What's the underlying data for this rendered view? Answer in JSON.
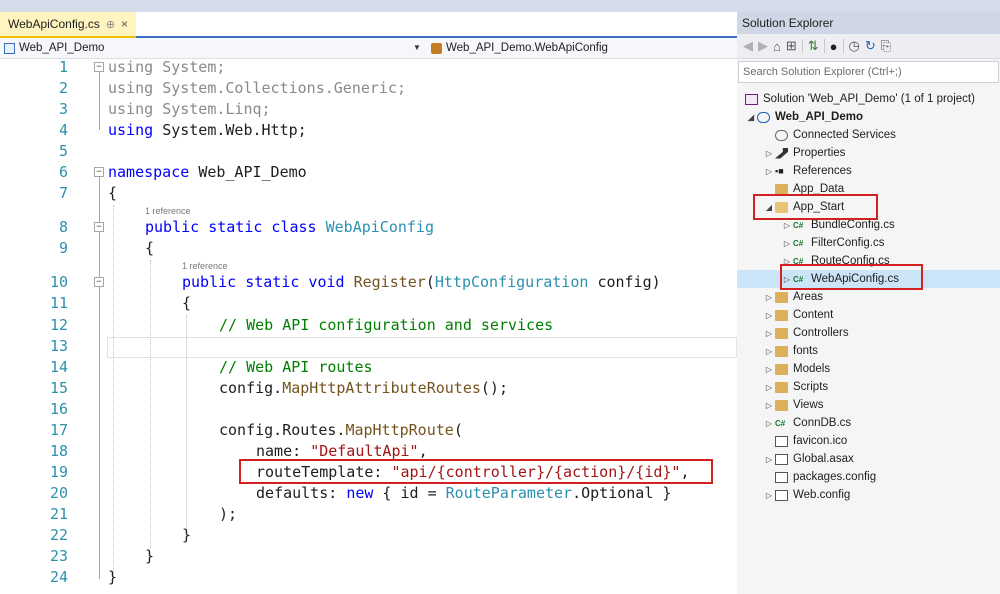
{
  "editor": {
    "tab_title": "WebApiConfig.cs",
    "tab_pin": "⊕",
    "tab_close": "×",
    "nav_left": "Web_API_Demo",
    "nav_right": "Web_API_Demo.WebApiConfig",
    "reference_label": "1 reference",
    "line_numbers": [
      "1",
      "2",
      "3",
      "4",
      "5",
      "6",
      "7",
      "8",
      "9",
      "10",
      "11",
      "12",
      "13",
      "14",
      "15",
      "16",
      "17",
      "18",
      "19",
      "20",
      "21",
      "22",
      "23",
      "24"
    ],
    "code": {
      "using": "using",
      "system": "System;",
      "system_collections": "System.Collections.Generic;",
      "system_linq": "System.Linq;",
      "system_web": "System.Web.Http;",
      "namespace": "namespace",
      "namespace_name": "Web_API_Demo",
      "open_brace": "{",
      "close_brace": "}",
      "public_static_class": "public static class",
      "class_name": "WebApiConfig",
      "public_static_void": "public static void",
      "register": "Register",
      "paren_open": "(",
      "http_config_type": "HttpConfiguration",
      "config_param": "config)",
      "comment1": "// Web API configuration and services",
      "comment2": "// Web API routes",
      "config_dot": "config.",
      "map_attr": "MapHttpAttributeRoutes",
      "call_end": "();",
      "config_routes": "config.Routes.",
      "map_route": "MapHttpRoute",
      "paren": "(",
      "name_key": "name: ",
      "name_val": "\"DefaultApi\"",
      "comma": ",",
      "route_key": "routeTemplate: ",
      "route_val": "\"api/{controller}/{action}/{id}\"",
      "defaults_key": "defaults: ",
      "new_kw": "new",
      "defaults_body": " { id = ",
      "route_param": "RouteParameter",
      "optional": ".Optional }",
      "close_call": ");"
    }
  },
  "solution_explorer": {
    "title": "Solution Explorer",
    "toolbar_icons": [
      "back-icon",
      "forward-icon",
      "home-icon",
      "switch-views-icon",
      "sync-icon",
      "pending-changes-icon",
      "history-icon",
      "refresh-icon",
      "collapse-icon"
    ],
    "search_placeholder": "Search Solution Explorer (Ctrl+;)",
    "solution": "Solution 'Web_API_Demo' (1 of 1 project)",
    "project": "Web_API_Demo",
    "items": [
      {
        "label": "Connected Services"
      },
      {
        "label": "Properties"
      },
      {
        "label": "References"
      },
      {
        "label": "App_Data"
      },
      {
        "label": "App_Start"
      },
      {
        "label": "BundleConfig.cs"
      },
      {
        "label": "FilterConfig.cs"
      },
      {
        "label": "RouteConfig.cs"
      },
      {
        "label": "WebApiConfig.cs"
      },
      {
        "label": "Areas"
      },
      {
        "label": "Content"
      },
      {
        "label": "Controllers"
      },
      {
        "label": "fonts"
      },
      {
        "label": "Models"
      },
      {
        "label": "Scripts"
      },
      {
        "label": "Views"
      },
      {
        "label": "ConnDB.cs"
      },
      {
        "label": "favicon.ico"
      },
      {
        "label": "Global.asax"
      },
      {
        "label": "packages.config"
      },
      {
        "label": "Web.config"
      }
    ],
    "cs_badge": "C#"
  },
  "colors": {
    "keyword": "#0000ff",
    "type": "#2b91af",
    "string": "#a31515",
    "comment": "#008000",
    "highlight": "#d32020",
    "selection": "#cce4f7"
  }
}
